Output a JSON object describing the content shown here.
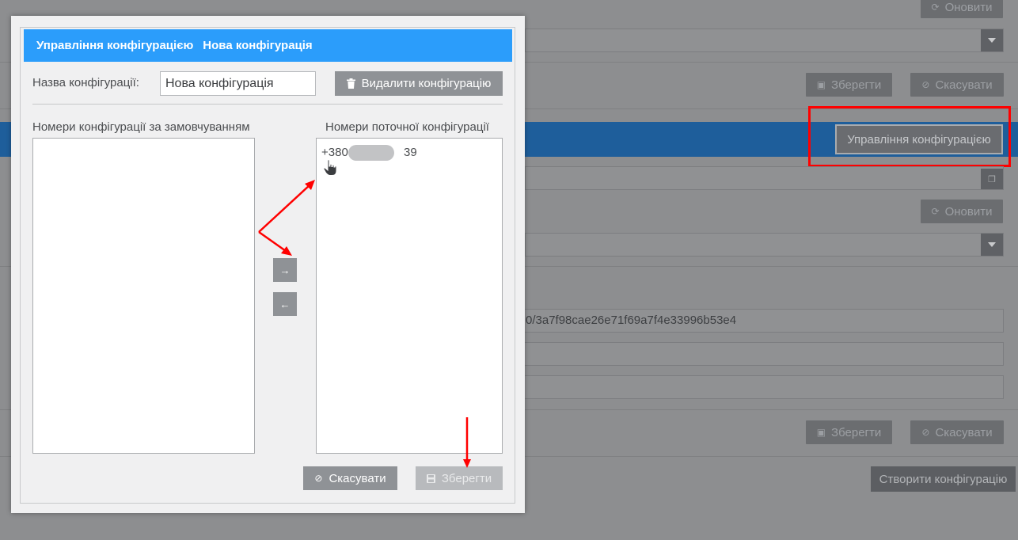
{
  "background": {
    "refresh_label": "Оновити",
    "save_label": "Зберегти",
    "cancel_label": "Скасувати",
    "config_management_label": "Управління конфігурацією",
    "url_fragment": "0/3a7f98cae26e71f69a7f4e33996b53e4",
    "create_config_label": "Створити конфігурацію"
  },
  "modal": {
    "header": {
      "title": "Управління конфігурацією",
      "subtitle": "Нова конфігурація"
    },
    "name_label": "Назва конфігурації:",
    "name_value": "Нова конфігурація",
    "delete_label": "Видалити конфігурацію",
    "default_numbers_title": "Номери конфігурації за замовчуванням",
    "current_numbers_title": "Номери поточної конфігурації",
    "default_numbers": [],
    "current_numbers": [
      {
        "prefix": "+380",
        "suffix": "39"
      }
    ],
    "move_right_icon": "arrow-right",
    "move_left_icon": "arrow-left",
    "cancel_label": "Скасувати",
    "save_label": "Зберегти"
  },
  "colors": {
    "header_blue": "#2b9dfb",
    "button_gray": "#8f9296",
    "annotation_red": "#ff0000"
  },
  "icons": {
    "refresh": "refresh-icon",
    "save": "floppy-icon",
    "cancel": "ban-icon",
    "delete": "trash-icon",
    "copy": "copy-icon",
    "dropdown": "chevron-down-icon",
    "cursor": "hand-pointer-icon"
  }
}
